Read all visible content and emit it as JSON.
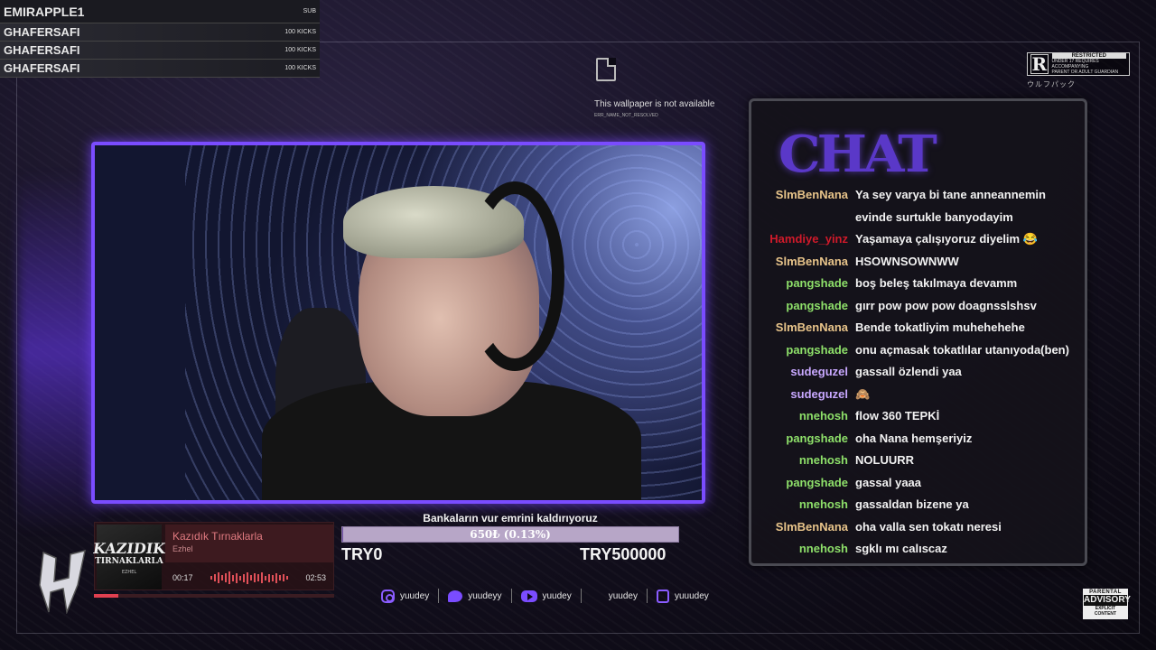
{
  "alerts": {
    "top": {
      "name": "EMIRAPPLE1",
      "tag": "SUB"
    },
    "rows": [
      {
        "name": "GHAFERSAFI",
        "tag": "100 KICKS"
      },
      {
        "name": "GHAFERSAFI",
        "tag": "100 KICKS"
      },
      {
        "name": "GHAFERSAFI",
        "tag": "100 KICKS"
      }
    ]
  },
  "wallpaper": {
    "message": "This wallpaper is not available",
    "code": "ERR_NAME_NOT_RESOLVED"
  },
  "rating": {
    "letter": "R",
    "title": "RESTRICTED",
    "line1": "UNDER 17 REQUIRES ACCOMPANYING",
    "line2": "PARENT OR ADULT GUARDIAN",
    "subtitle": "ウルフパック"
  },
  "chat": {
    "logo": "CHAT",
    "messages": [
      {
        "user": "SlmBenNana",
        "color": "#e8c48a",
        "text": "Ya sey varya bi tane anneannemin evinde surtukle banyodayim"
      },
      {
        "user": "Hamdiye_yinz",
        "color": "#d01a2a",
        "text": "Yaşamaya çalışıyoruz diyelim 😂"
      },
      {
        "user": "SlmBenNana",
        "color": "#e8c48a",
        "text": "HSOWNSOWNWW"
      },
      {
        "user": "pangshade",
        "color": "#8ee06a",
        "text": "boş beleş takılmaya devamm"
      },
      {
        "user": "pangshade",
        "color": "#8ee06a",
        "text": "gırr pow pow pow doagnsslshsv"
      },
      {
        "user": "SlmBenNana",
        "color": "#e8c48a",
        "text": "Bende tokatliyim muhehehehe"
      },
      {
        "user": "pangshade",
        "color": "#8ee06a",
        "text": "onu açmasak tokatlılar utanıyoda(ben)"
      },
      {
        "user": "sudeguzel",
        "color": "#c8a8ff",
        "text": "gassall özlendi yaa"
      },
      {
        "user": "sudeguzel",
        "color": "#c8a8ff",
        "text": "🙈"
      },
      {
        "user": "nnehosh",
        "color": "#8ee06a",
        "text": "flow 360 TEPKİ"
      },
      {
        "user": "pangshade",
        "color": "#8ee06a",
        "text": "oha Nana hemşeriyiz"
      },
      {
        "user": "nnehosh",
        "color": "#8ee06a",
        "text": "NOLUURR"
      },
      {
        "user": "pangshade",
        "color": "#8ee06a",
        "text": "gassal yaaa"
      },
      {
        "user": "nnehosh",
        "color": "#8ee06a",
        "text": "gassaldan bizene ya"
      },
      {
        "user": "SlmBenNana",
        "color": "#e8c48a",
        "text": "oha valla sen tokatı neresi"
      },
      {
        "user": "nnehosh",
        "color": "#8ee06a",
        "text": "sgklı mı calıscaz"
      }
    ]
  },
  "goal": {
    "title": "Bankaların vur emrini kaldırıyoruz",
    "amount": "650₺ (0.13%)",
    "fraction": 0.0013,
    "min_label": "TRY0",
    "max_label": "TRY500000"
  },
  "music": {
    "cover_line1": "KAZIDIK",
    "cover_line2": "TIRNAKLARLA",
    "cover_line3": "EZHEL",
    "title": "Kazıdık Tırnaklarla",
    "artist": "Ezhel",
    "elapsed": "00:17",
    "duration": "02:53",
    "progress": 0.1
  },
  "socials": [
    {
      "icon": "instagram-icon",
      "cls": "ig",
      "handle": "yuudey"
    },
    {
      "icon": "twitter-icon",
      "cls": "tw",
      "handle": "yuudeyy"
    },
    {
      "icon": "youtube-icon",
      "cls": "yt",
      "handle": "yuudey"
    },
    {
      "icon": "tiktok-icon",
      "cls": "tt",
      "handle": "yuudey"
    },
    {
      "icon": "kick-icon",
      "cls": "tk",
      "handle": "yuuudey"
    }
  ],
  "parental": {
    "top": "PARENTAL",
    "mid": "ADVISORY",
    "bot": "EXPLICIT CONTENT"
  },
  "colors": {
    "accent": "#7a4cff",
    "music_accent": "#e04050"
  }
}
